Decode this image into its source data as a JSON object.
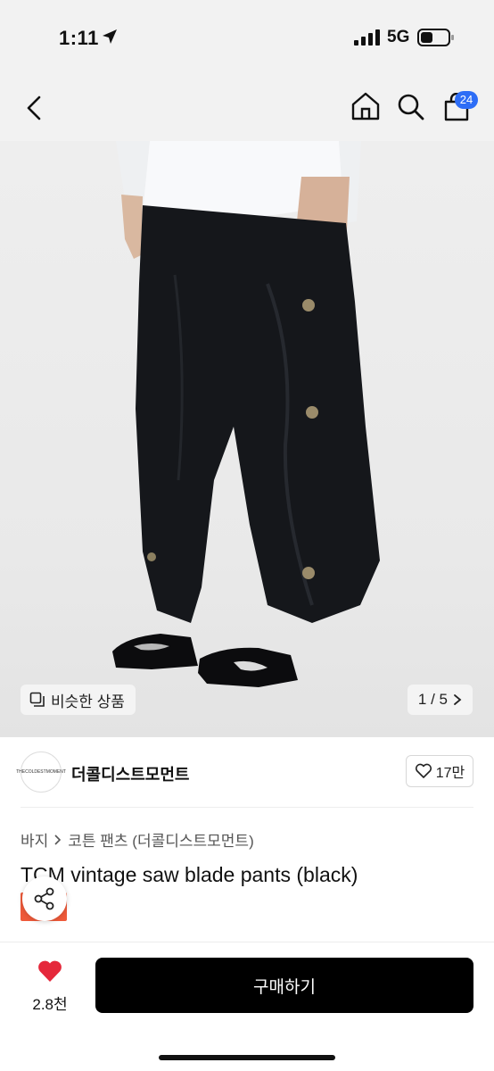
{
  "status": {
    "time": "1:11",
    "network": "5G"
  },
  "nav": {
    "cart_count": "24"
  },
  "gallery": {
    "similar_label": "비슷한 상품",
    "pager": "1 / 5"
  },
  "brand": {
    "name": "더콜디스트모먼트",
    "logo_text": "THECOLDESTMOMENT",
    "likes": "17만"
  },
  "breadcrumb": {
    "level1": "바지",
    "level2": "코튼 팬츠 (더콜디스트모먼트)"
  },
  "product": {
    "title": "TCM vintage saw blade pants (black)"
  },
  "footer": {
    "fav_count": "2.8천",
    "buy_label": "구매하기"
  },
  "colors": {
    "accent_badge": "#2d6df6",
    "heart": "#e5283b",
    "tag": "#ef5a3a",
    "buy_bg": "#000000"
  },
  "icons": [
    "location-arrow-icon",
    "signal-icon",
    "battery-icon",
    "back-icon",
    "home-icon",
    "search-icon",
    "cart-icon",
    "similar-icon",
    "chevron-right-icon",
    "heart-outline-icon",
    "share-icon",
    "heart-filled-icon"
  ]
}
